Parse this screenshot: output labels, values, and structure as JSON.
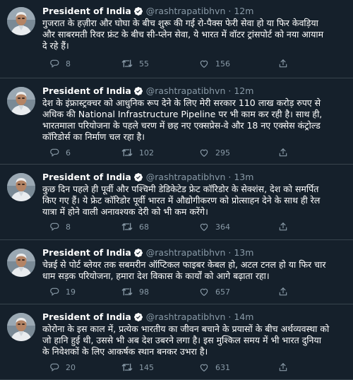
{
  "colors": {
    "background": "#15202b",
    "divider": "#38444d",
    "muted": "#8899a6",
    "verified": "#1da1f2"
  },
  "tweets": [
    {
      "name": "President of India",
      "handle": "@rashtrapatibhvn",
      "dot": "·",
      "time": "12m",
      "text": "गुजरात के हज़ीरा और घोघा के बीच शुरू की गई रो-पैक्स फेरी सेवा हो या फिर केवड़िया\nऔर साबरमती रिवर फ्रंट के बीच सी-प्लेन सेवा, ये भारत में वॉटर ट्रांसपोर्ट को नया आयाम\nदे रहे हैं।",
      "replies": "8",
      "retweets": "55",
      "likes": "156"
    },
    {
      "name": "President of India",
      "handle": "@rashtrapatibhvn",
      "dot": "·",
      "time": "12m",
      "text": "देश के इंफ्रास्ट्रक्चर को आधुनिक रूप देने के लिए मेरी सरकार 110 लाख करोड़ रुपए से\nअधिक की National Infrastructure Pipeline पर भी काम कर रही है। साथ ही,\nभारतमाला परियोजना के पहले चरण में छह नए एक्सप्रेस-वे और 18 नए एक्सेस कंट्रोल्ड\nकॉरिडोर्स का निर्माण चल रहा है।",
      "replies": "6",
      "retweets": "102",
      "likes": "295"
    },
    {
      "name": "President of India",
      "handle": "@rashtrapatibhvn",
      "dot": "·",
      "time": "13m",
      "text": "कुछ दिन पहले ही पूर्वी और पश्चिमी डेडिकेटेड फ्रेट कॉरिडोर के सेक्शंस, देश को समर्पित\nकिए गए हैं। ये फ्रेट कॉरिडोर पूर्वी भारत में औद्योगीकरण को प्रोत्साहन देने के साथ ही रेल\nयात्रा में होने वाली अनावश्यक देरी को भी कम करेंगे।",
      "replies": "8",
      "retweets": "68",
      "likes": "364"
    },
    {
      "name": "President of India",
      "handle": "@rashtrapatibhvn",
      "dot": "·",
      "time": "13m",
      "text": "चेन्नई से पोर्ट ब्लेयर तक सबमरीन ऑप्टिकल फाइबर केबल हो, अटल टनल हो या फिर चार\nधाम सड़क परियोजना, हमारा देश विकास के कार्यों को आगे बढ़ाता रहा।",
      "replies": "19",
      "retweets": "98",
      "likes": "657"
    },
    {
      "name": "President of India",
      "handle": "@rashtrapatibhvn",
      "dot": "·",
      "time": "14m",
      "text": "कोरोना के इस काल में, प्रत्येक भारतीय का जीवन बचाने के प्रयासों के बीच अर्थव्यवस्था को\nजो हानि हुई थी, उससे भी अब देश उबरने लगा है। इस मुश्किल समय में भी भारत दुनिया\nके निवेशकों के लिए आकर्षक स्थान बनकर उभरा है।",
      "replies": "20",
      "retweets": "145",
      "likes": "631"
    }
  ]
}
